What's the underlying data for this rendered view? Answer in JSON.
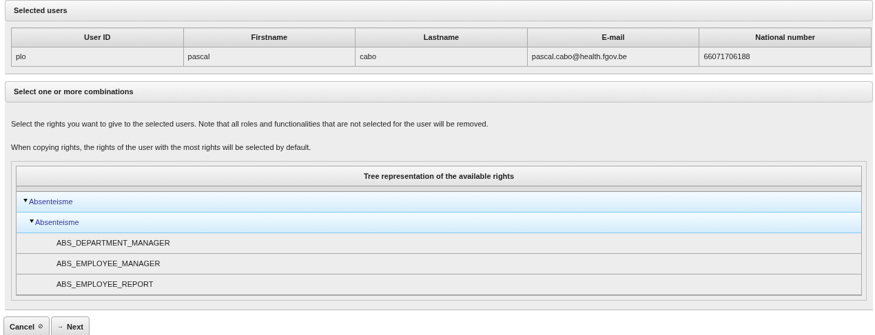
{
  "selected_users": {
    "title": "Selected users",
    "table": {
      "columns": [
        "User ID",
        "Firstname",
        "Lastname",
        "E-mail",
        "National number"
      ],
      "rows": [
        [
          "plo",
          "pascal",
          "cabo",
          "pascal.cabo@health.fgov.be",
          "66071706188"
        ]
      ]
    }
  },
  "combinations": {
    "title": "Select one or more combinations",
    "paragraphs": [
      "Select the rights you want to give to the selected users. Note that all roles and functionalities that are not selected for the user will be removed.",
      "When copying rights, the rights of the user with the most rights will be selected by default."
    ],
    "tree": {
      "heading": "Tree representation of the available rights",
      "items": [
        {
          "label": "Absenteisme",
          "expanded": true,
          "selected": true,
          "children": [
            {
              "label": "Absenteisme",
              "expanded": true,
              "selected": true,
              "children": [
                {
                  "label": "ABS_DEPARTMENT_MANAGER",
                  "selected": false
                },
                {
                  "label": "ABS_EMPLOYEE_MANAGER",
                  "selected": false
                },
                {
                  "label": "ABS_EMPLOYEE_REPORT",
                  "selected": false
                }
              ]
            }
          ]
        }
      ]
    }
  },
  "buttons": [
    {
      "label": "Cancel",
      "icon": "⊘",
      "kind": "trailing"
    },
    {
      "label": "Next",
      "icon": "→",
      "kind": "leading"
    }
  ]
}
